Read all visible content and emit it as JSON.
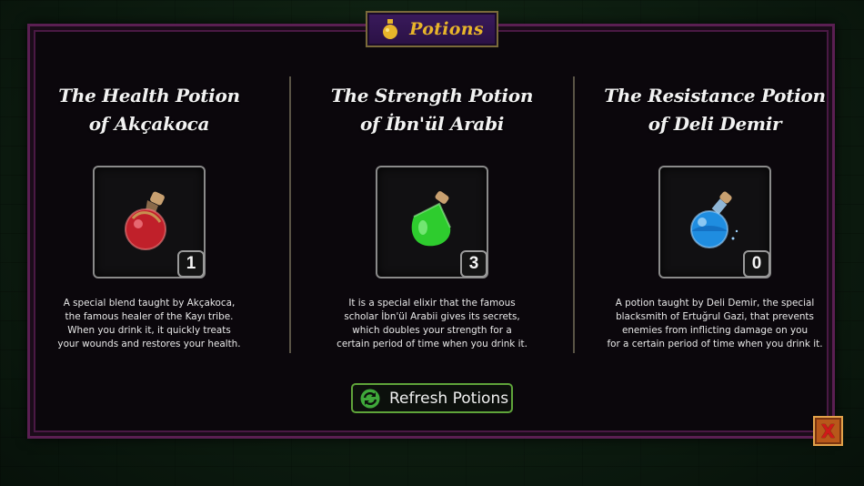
{
  "header": {
    "title": "Potions",
    "icon": "potion-flask-icon"
  },
  "potions": [
    {
      "title_line1": "The Health Potion",
      "title_line2": "of Akçakoca",
      "count": "1",
      "color": "#c0202a",
      "icon": "red-round-potion-icon",
      "desc": [
        "A special blend taught by Akçakoca,",
        "the famous healer of the Kayı tribe.",
        "When you drink it, it quickly treats",
        "your wounds and restores your health."
      ]
    },
    {
      "title_line1": "The Strength Potion",
      "title_line2": "of İbn'ül Arabi",
      "count": "3",
      "color": "#2ecc2e",
      "icon": "green-flask-potion-icon",
      "desc": [
        "It is a special elixir that the famous",
        "scholar İbn'ül Arabii gives its secrets,",
        "which doubles your strength for a",
        "certain period of time when you drink it."
      ]
    },
    {
      "title_line1": "The Resistance Potion",
      "title_line2": "of Deli Demir",
      "count": "0",
      "color": "#1f8de0",
      "icon": "blue-round-potion-icon",
      "desc": [
        "A potion taught by Deli Demir, the special",
        "blacksmith of Ertuğrul Gazi, that prevents",
        "enemies from inflicting damage on you",
        "for a certain period of time when you drink it."
      ]
    }
  ],
  "refresh": {
    "label": "Refresh Potions",
    "icon": "refresh-icon"
  },
  "close": {
    "label": "X",
    "icon": "close-icon"
  }
}
